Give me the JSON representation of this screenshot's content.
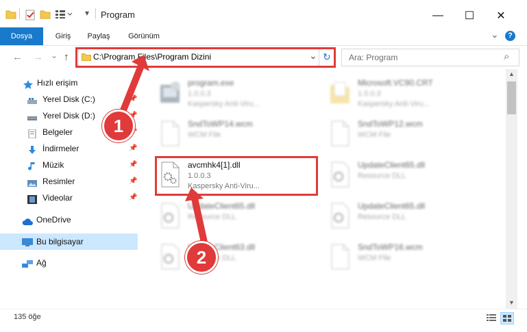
{
  "window": {
    "title": "Program",
    "minimize": "—",
    "maximize": "☐",
    "close": "✕"
  },
  "ribbon": {
    "tabs": [
      "Dosya",
      "Giriş",
      "Paylaş",
      "Görünüm"
    ],
    "expand": "⌄",
    "help": "?"
  },
  "nav": {
    "back": "←",
    "forward": "→",
    "recent": "⌄",
    "up": "↑",
    "address": "C:\\Program Files\\Program Dizini",
    "dropdown": "⌄",
    "refresh": "↻",
    "search_placeholder": "Ara: Program",
    "search_icon": "⌕"
  },
  "sidebar": {
    "items": [
      {
        "label": "Hızlı erişim",
        "icon": "star-icon"
      },
      {
        "label": "Yerel Disk (C:)",
        "icon": "drive-icon",
        "pinned": "📌"
      },
      {
        "label": "Yerel Disk (D:)",
        "icon": "drive-icon",
        "pinned": "📌"
      },
      {
        "label": "Belgeler",
        "icon": "document-icon",
        "pinned": "📌"
      },
      {
        "label": "İndirmeler",
        "icon": "download-icon",
        "pinned": "📌"
      },
      {
        "label": "Müzik",
        "icon": "music-icon",
        "pinned": "📌"
      },
      {
        "label": "Resimler",
        "icon": "pictures-icon",
        "pinned": "📌"
      },
      {
        "label": "Videolar",
        "icon": "video-icon",
        "pinned": "📌"
      },
      {
        "label": "OneDrive",
        "icon": "cloud-icon"
      },
      {
        "label": "Bu bilgisayar",
        "icon": "computer-icon"
      },
      {
        "label": "Ağ",
        "icon": "network-icon"
      }
    ]
  },
  "files": [
    {
      "name": "program.exe",
      "line2": "1.0.0.3",
      "line3": "Kaspersky Anti-Viru..."
    },
    {
      "name": "Microsoft.VC90.CRT",
      "line2": "1.0.0.3",
      "line3": "Kaspersky Anti-Viru..."
    },
    {
      "name": "SndToWP14.wcm",
      "line2": "WCM File",
      "line3": ""
    },
    {
      "name": "SndToWP12.wcm",
      "line2": "WCM File",
      "line3": ""
    },
    {
      "name": "avcmhk4[1].dll",
      "line2": "1.0.0.3",
      "line3": "Kaspersky Anti-Viru..."
    },
    {
      "name": "UpdateClient65.dll",
      "line2": "Resource DLL",
      "line3": ""
    },
    {
      "name": "UpdateClient65.dll",
      "line2": "Resource DLL",
      "line3": ""
    },
    {
      "name": "UpdateClient65.dll",
      "line2": "Resource DLL",
      "line3": ""
    },
    {
      "name": "UpdateClient63.dll",
      "line2": "Resource DLL",
      "line3": ""
    },
    {
      "name": "SndToWP16.wcm",
      "line2": "WCM File",
      "line3": ""
    }
  ],
  "status": {
    "count": "135 öğe"
  },
  "annotations": {
    "step1": "1",
    "step2": "2",
    "color": "#e03a3a"
  }
}
